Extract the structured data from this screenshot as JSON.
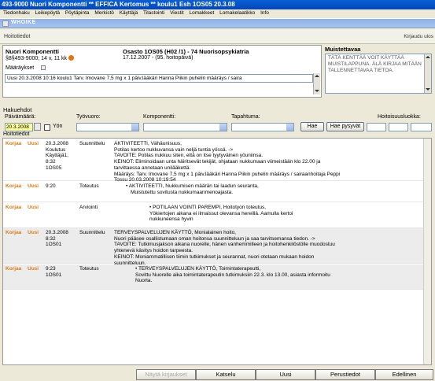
{
  "window": {
    "title": "493-9000 Nuori Komponentti  ** EFFICA Kertomus **  koulu1 Esh  1OS05  20.3.08"
  },
  "menu": [
    "Tiedonhaku",
    "Leikepöytä",
    "Pöytäpinta",
    "Merkistö",
    "Käyttäjä",
    "Tilastointi",
    "Viestit",
    "Lomakkeet",
    "Lomakelaatikko",
    "Info"
  ],
  "window_tab": "WHOIKE",
  "section": {
    "title": "Hoitotiedot",
    "right_link": "Kirjaudu ulos"
  },
  "patient": {
    "name": "Nuori Komponentti",
    "id_line": "§8§493-9000; 14 v, 11 kk",
    "ward": "Osasto 1OS05 (H02 /1) - 74 Nuorisopsykiatria",
    "date": "17.12.2007 - (95. hoitopäivä)",
    "maaraykset_label": "Määräykset",
    "maaraykset_value": "Uusi 20.3.2008 10:16  koulu1 Tarv. Imovane 7,5 mg x 1 päiv.lääkäri Hanna Piikin puhelin määräys / saira"
  },
  "muistettavaa": {
    "label": "Muistettavaa",
    "text": "TÄTÄ KENTTÄÄ VOIT KÄYTTÄÄ MUISTILAPPUNA. ÄLÄ KIRJAA MITÄÄN TALLENNETTAVAA TIETOA."
  },
  "hakuehdot": {
    "title": "Hakuehdot",
    "paivamaara_label": "Päivämäärä:",
    "paivamaara_value": "20.3.2008",
    "yon_label": "Yön",
    "tyovuoro_label": "Työvuoro:",
    "komponentti_label": "Komponentti:",
    "tapahtuma_label": "Tapahtuma:",
    "hae_label": "Hae",
    "hae_pysyvat_label": "Hae pysyvät",
    "hoitoisuus_label": "Hoitoisuusluokka:"
  },
  "table": {
    "title": "Hoitotiedot",
    "action_korjaa": "Korjaa",
    "action_uusi": "Uusi",
    "rows": [
      {
        "meta": [
          "20.3.2008",
          "Koulutus",
          "Käyttäjä1,",
          "8:32",
          "1OS05"
        ],
        "kind": "Suunnittelu",
        "lines": [
          "AKTIVITEETTI, Vähäunisuus,",
          "Potilas kertoo nukkuvansa vain neljä tuntia yössä. ->",
          "TAVOITE: Potilas nukkuu siten, että on itse tyytyväinen yöuniinsa.",
          "KEINOT: Eliminoidaan unta häiritsevät tekijät, ohjataan nukkumaan viimeistään klo 22.00 ja",
          "tarvittaessa annetaan unilääkettä.",
          "Määräys: Tarv. Imovane 7,5 mg x 1 päiv.lääkäri Hanna Piikin puhelin määräys / sairaanhoitaja Peppi",
          "Tossu 20.03.2008 10:19:54"
        ],
        "grey": false
      },
      {
        "meta": [
          "9:20"
        ],
        "kind": "Toteutus",
        "lines": [
          "• AKTIVITEETTI, Nukkumisen määrän tai laadun seuranta,",
          "Muistutettu sovitusta nukkumaanmenoajasta."
        ],
        "grey": false
      },
      {
        "meta": [],
        "kind": "Arviointi",
        "lines": [
          "• POTILAAN VOINTI PAREMPI, Hoitotyon toteutus,",
          "Yökiertojen aikana ei ilmaissut olevansa hereillä. Aamulla kertoi",
          "nukkuneensa hyvin"
        ],
        "grey": false
      },
      {
        "meta": [
          "20.3.2008",
          "8:32",
          "1OS01"
        ],
        "kind": "Suunnittelu",
        "lines": [
          "TERVEYSPALVELUJEN KÄYTTÖ, Monialainen hoito,",
          "Nuori pääsee osallistumaan oman hoitonsa suunnitteluun ja saa tarvitsemansa tiedon. ->",
          "TAVOITE: Tutkimusjakson aikana nuorelle, hänen vanhemmilleen ja hoitohenkilöstölle muodostuu",
          "yhtenevä käsitys hoidon tarpeesta.",
          "KEINOT: Moniammatillisen tiimin tutkimukset ja seurannat, nuori otetaan mukaan hoidon",
          "suunnitteluun."
        ],
        "grey": true
      },
      {
        "meta": [
          "9:23",
          "1OS01"
        ],
        "kind": "Toteutus",
        "lines": [
          "• TERVEYSPALVELUJEN KÄYTTÖ, Toimintaterapeutti,",
          "Sovittu Nuorelle aika toimintaterapeutin tutkimuksiin 22.3. klo 13.00, asiasta informoitu",
          "Nuorta."
        ],
        "grey": true
      }
    ]
  },
  "bottom_buttons": {
    "disabled": "Näytä kirjaukset",
    "katselu": "Katselu",
    "uusi": "Uusi",
    "perustiedot": "Perustiedot",
    "edellinen": "Edellinen"
  }
}
